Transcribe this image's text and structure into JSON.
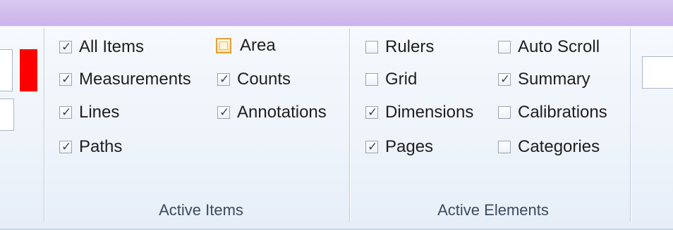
{
  "ribbon": {
    "left_panel": {
      "swatch_color": "#ff0000"
    },
    "active_items": {
      "label": "Active Items",
      "checkboxes": [
        {
          "label": "All Items",
          "checked": true
        },
        {
          "label": "Measurements",
          "checked": true
        },
        {
          "label": "Lines",
          "checked": true
        },
        {
          "label": "Paths",
          "checked": true
        },
        {
          "label": "Area",
          "checked": false,
          "highlighted": true
        },
        {
          "label": "Counts",
          "checked": true
        },
        {
          "label": "Annotations",
          "checked": true
        }
      ]
    },
    "active_elements": {
      "label": "Active Elements",
      "checkboxes": [
        {
          "label": "Rulers",
          "checked": false
        },
        {
          "label": "Grid",
          "checked": false
        },
        {
          "label": "Dimensions",
          "checked": true
        },
        {
          "label": "Pages",
          "checked": true
        },
        {
          "label": "Auto Scroll",
          "checked": false
        },
        {
          "label": "Summary",
          "checked": true
        },
        {
          "label": "Calibrations",
          "checked": false
        },
        {
          "label": "Categories",
          "checked": false
        }
      ]
    }
  }
}
